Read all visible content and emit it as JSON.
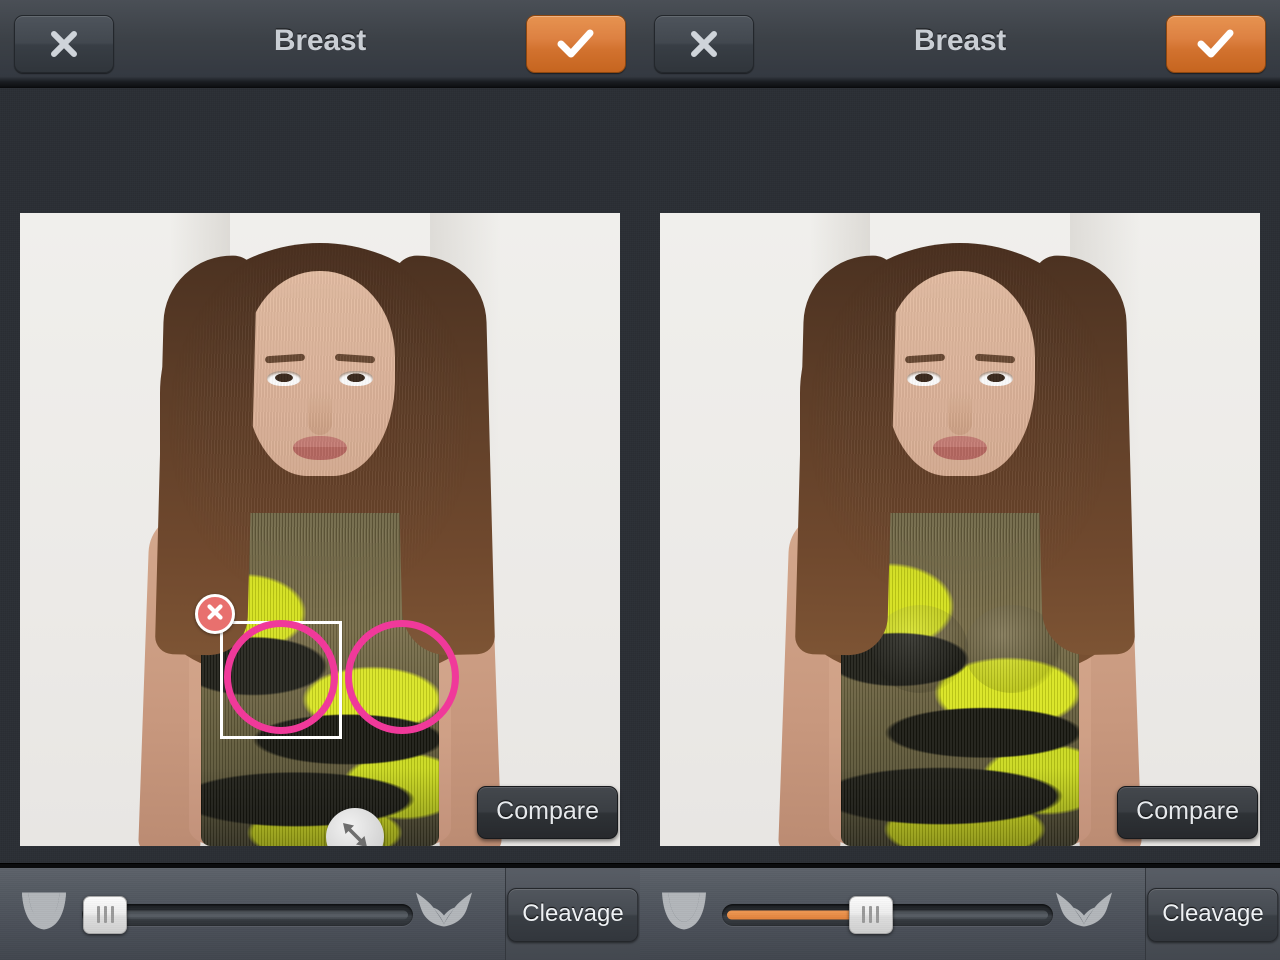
{
  "app": {
    "title": "Breast",
    "accent_orange": "#dd8142",
    "selection_pink": "#f0399a",
    "delete_red": "#e8706e",
    "bar_dark": "#3c4147",
    "toolbar_gray": "#4b5059",
    "photo_bg": "#efeeec"
  },
  "panels": [
    {
      "id": "left",
      "title": "Breast",
      "close_button": {
        "label": "",
        "icon": "close-x-icon"
      },
      "confirm_button": {
        "label": "",
        "icon": "checkmark-icon"
      },
      "compare_button": {
        "label": "Compare"
      },
      "cleavage_button": {
        "label": "Cleavage"
      },
      "slider": {
        "min_icon": "small-bra-icon",
        "max_icon": "full-bra-icon",
        "value_percent": 5,
        "fill_visible": false
      },
      "selection": {
        "visible": true,
        "delete_badge": "delete-x-icon",
        "resize_handle": "diagonal-resize-arrow-icon",
        "circle_count": 2
      }
    },
    {
      "id": "right",
      "title": "Breast",
      "close_button": {
        "label": "",
        "icon": "close-x-icon"
      },
      "confirm_button": {
        "label": "",
        "icon": "checkmark-icon"
      },
      "compare_button": {
        "label": "Compare"
      },
      "cleavage_button": {
        "label": "Cleavage"
      },
      "slider": {
        "min_icon": "small-bra-icon",
        "max_icon": "full-bra-icon",
        "value_percent": 43,
        "fill_visible": true
      },
      "selection": {
        "visible": false,
        "delete_badge": "",
        "resize_handle": "",
        "circle_count": 0
      }
    }
  ]
}
